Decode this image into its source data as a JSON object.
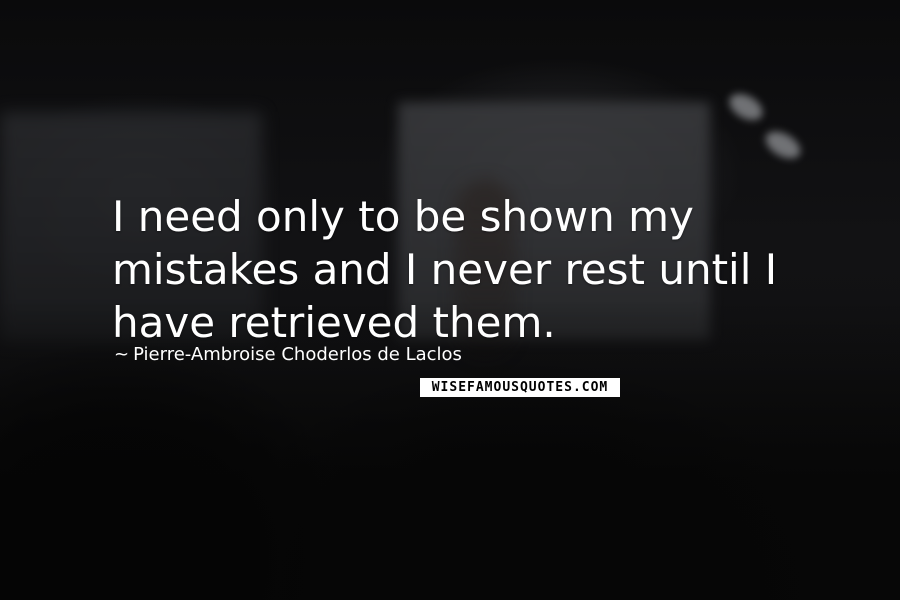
{
  "quote": {
    "text": "I need only to be shown my mistakes and I never rest until I have retrieved them."
  },
  "author": {
    "prefix": "~",
    "name": "Pierre-Ambroise Choderlos de Laclos"
  },
  "watermark": {
    "text": "WISEFAMOUSQUOTES.COM"
  },
  "colors": {
    "text": "#ffffff",
    "background": "#0b0b0c",
    "watermark_bg": "#ffffff",
    "watermark_text": "#000000"
  }
}
